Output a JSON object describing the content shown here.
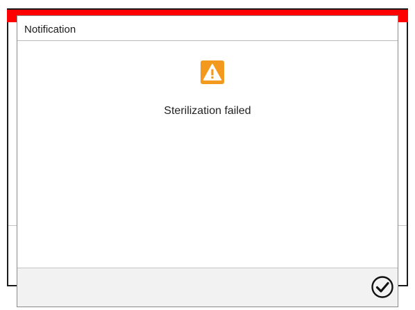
{
  "dialog": {
    "title": "Notification",
    "message": "Sterilization failed",
    "icon": "warning-icon",
    "confirm_icon": "checkmark-circle-icon"
  },
  "colors": {
    "alarm_bar": "#ff0000",
    "warning_icon_bg": "#f39a1e",
    "footer_bg": "#f2f2f2"
  }
}
